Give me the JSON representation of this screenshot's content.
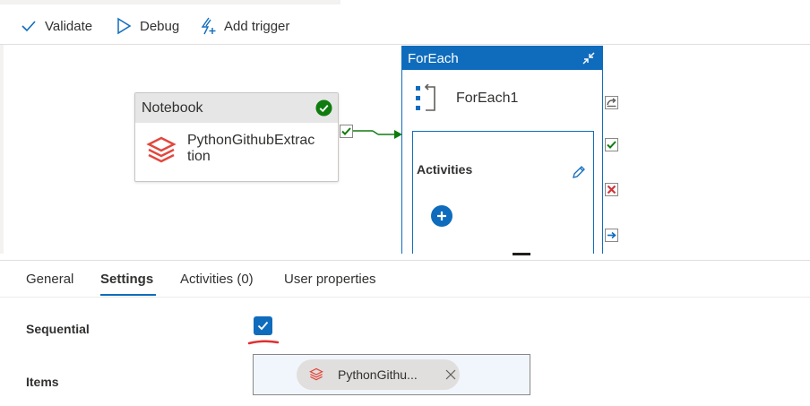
{
  "toolbar": {
    "validate_label": "Validate",
    "debug_label": "Debug",
    "add_trigger_label": "Add trigger"
  },
  "canvas": {
    "notebook": {
      "type_label": "Notebook",
      "name": "PythonGithubExtrac tion",
      "status": "succeeded"
    },
    "foreach": {
      "type_label": "ForEach",
      "name": "ForEach1",
      "inner_title": "Activities"
    }
  },
  "tabs": [
    {
      "label": "General",
      "active": false
    },
    {
      "label": "Settings",
      "active": true
    },
    {
      "label": "Activities (0)",
      "active": false
    },
    {
      "label": "User properties",
      "active": false
    }
  ],
  "settings": {
    "sequential_label": "Sequential",
    "sequential_checked": true,
    "items_label": "Items",
    "items_chip": "PythonGithu..."
  },
  "colors": {
    "accent": "#0f6cbd",
    "success": "#107c10",
    "error": "#d13438",
    "databricks": "#e2473d"
  },
  "icons": [
    "check-icon",
    "play-icon",
    "trigger-icon",
    "success-icon",
    "databricks-icon",
    "collapse-icon",
    "foreach-icon",
    "pencil-icon",
    "plus-icon",
    "skip-icon",
    "completion-icon",
    "failure-icon",
    "arrow-right-icon",
    "close-icon"
  ]
}
